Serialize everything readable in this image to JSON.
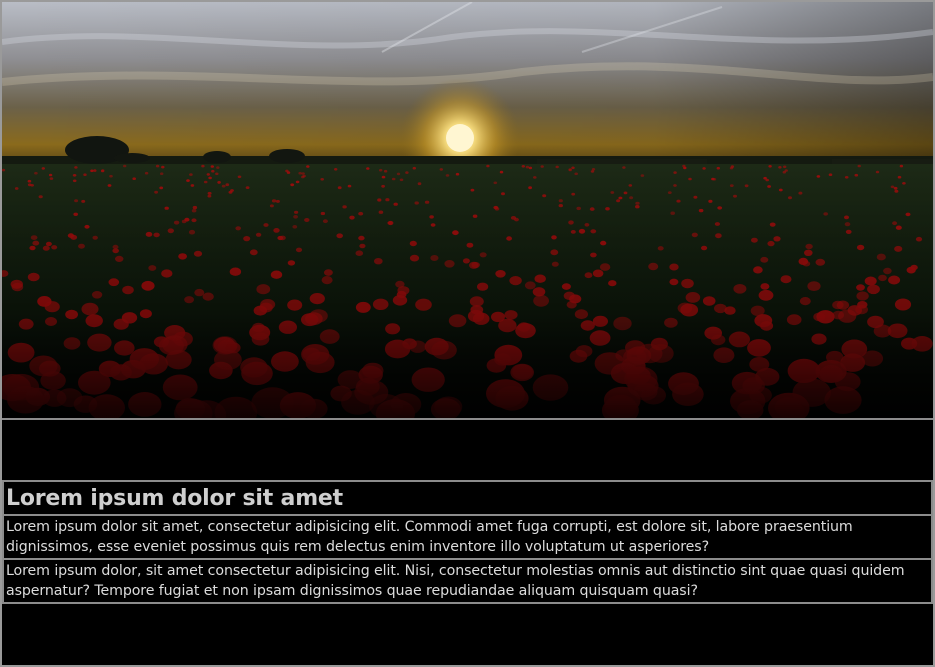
{
  "hero": {
    "image": "poppy-field-sunset"
  },
  "article": {
    "title": "Lorem ipsum dolor sit amet",
    "paragraphs": [
      "Lorem ipsum dolor sit amet, consectetur adipisicing elit. Commodi amet fuga corrupti, est dolore sit, labore praesentium dignissimos, esse eveniet possimus quis rem delectus enim inventore illo voluptatum ut asperiores?",
      "Lorem ipsum dolor, sit amet consectetur adipisicing elit. Nisi, consectetur molestias omnis aut distinctio sint quae quasi quidem aspernatur? Tempore fugiat et non ipsam dignissimos quae repudiandae aliquam quisquam quasi?"
    ]
  },
  "colors": {
    "page_background": "#000000",
    "border": "#8c8c8c",
    "title_text": "#cfcfcf",
    "body_text": "#dcdcdc",
    "poppy_red": "#a30c0c"
  }
}
